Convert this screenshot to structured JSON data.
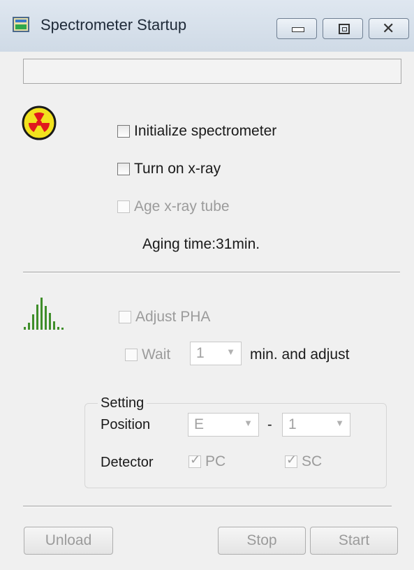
{
  "window": {
    "title": "Spectrometer Startup",
    "controls": {
      "minimize_icon": "minimize-icon",
      "maximize_icon": "maximize-icon",
      "close_icon": "close-icon",
      "close_glyph": "✕"
    }
  },
  "status_text": "",
  "xray": {
    "icon": "radiation-icon",
    "initialize_label": "Initialize spectrometer",
    "turn_on_label": "Turn on x-ray",
    "age_label": "Age x-ray tube",
    "aging_time": "Aging time:31min."
  },
  "pha": {
    "icon": "spectrum-bars-icon",
    "adjust_label": "Adjust PHA",
    "wait_label": "Wait",
    "wait_value": "1",
    "wait_suffix": "min. and adjust",
    "setting_title": "Setting",
    "position_label": "Position",
    "position_value_1": "E",
    "position_separator": "-",
    "position_value_2": "1",
    "detector_label": "Detector",
    "detector_pc": "PC",
    "detector_sc": "SC",
    "detector_pc_checked": true,
    "detector_sc_checked": true
  },
  "buttons": {
    "unload": "Unload",
    "stop": "Stop",
    "start": "Start"
  },
  "colors": {
    "radiation_yellow": "#f2e21e",
    "radiation_red": "#e0191e",
    "bars_green": "#3f8e2a"
  }
}
